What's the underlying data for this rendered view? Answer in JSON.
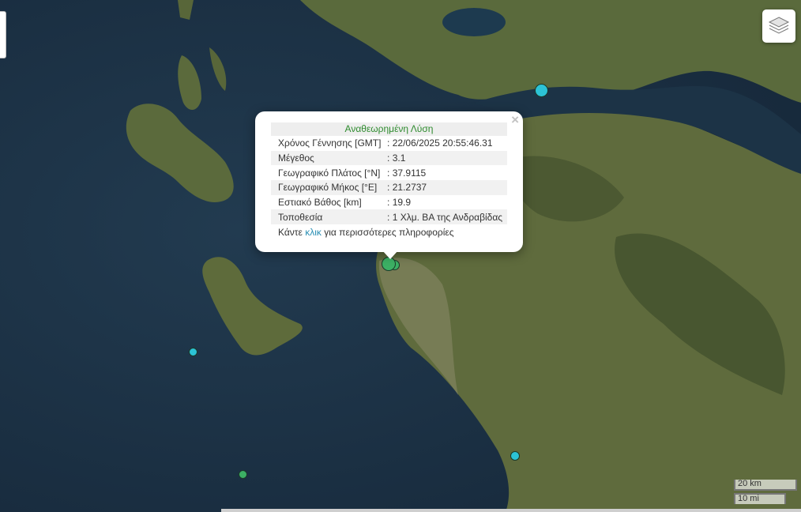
{
  "popup": {
    "title": "Αναθεωρημένη Λύση",
    "close_glyph": "×",
    "rows": [
      {
        "label": "Χρόνος Γέννησης [GMT]",
        "value": ": 22/06/2025 20:55:46.31"
      },
      {
        "label": "Μέγεθος",
        "value": ": 3.1"
      },
      {
        "label": "Γεωγραφικό Πλάτος [°N]",
        "value": ": 37.9115"
      },
      {
        "label": "Γεωγραφικό Μήκος [°E]",
        "value": ": 21.2737"
      },
      {
        "label": "Εστιακό Βάθος [km]",
        "value": ": 19.9"
      },
      {
        "label": "Τοποθεσία",
        "value": ": 1 Χλμ. ΒΑ της Ανδραβίδας"
      }
    ],
    "more_prefix": "Κάντε ",
    "more_link": "κλικ",
    "more_suffix": " για περισσότερες πληροφορίες"
  },
  "scale": {
    "km": "20 km",
    "mi": "10 mi"
  },
  "controls": {
    "layers_icon": "layers-icon"
  },
  "colors": {
    "marker_green": "#3cb064",
    "marker_cyan": "#2cc3d6",
    "sea": "#1e3447",
    "land": "#5b6a3a"
  }
}
